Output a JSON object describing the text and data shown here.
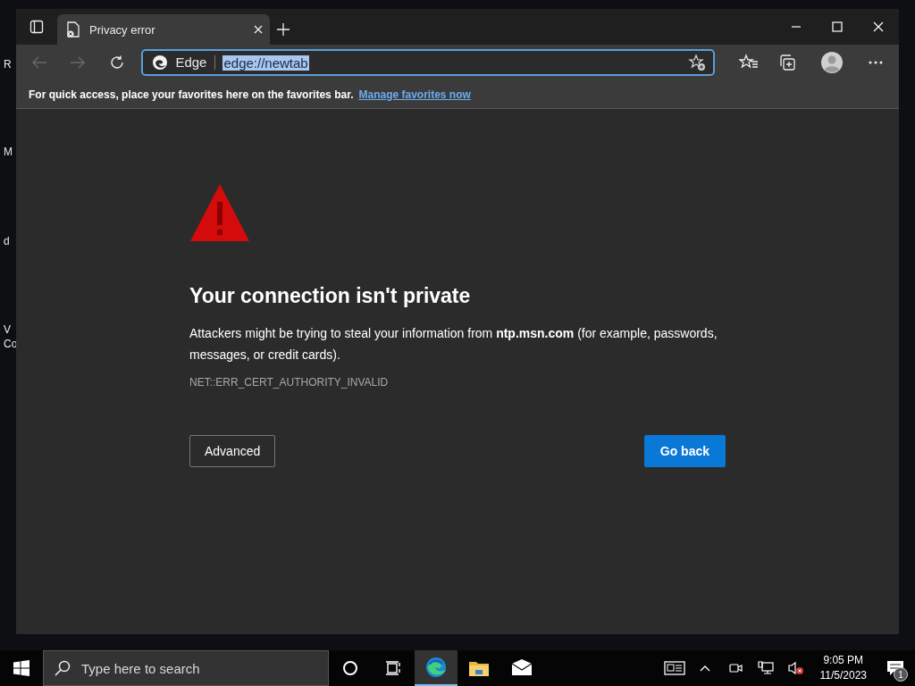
{
  "desktop": {
    "icon_labels": [
      {
        "text": "R"
      },
      {
        "text": "M"
      },
      {
        "text": "d"
      },
      {
        "text": "V"
      },
      {
        "text": "Co"
      }
    ]
  },
  "browser": {
    "tabs": [
      {
        "title": "Privacy error",
        "selected": true
      }
    ],
    "nav": {
      "back_disabled": true,
      "forward_disabled": true
    },
    "address": {
      "site_label": "Edge",
      "url": "edge://newtab",
      "url_selected": true
    },
    "favorites_bar": {
      "message": "For quick access, place your favorites here on the favorites bar.",
      "link": "Manage favorites now"
    },
    "page": {
      "heading": "Your connection isn't private",
      "body": "Attackers might be trying to steal your information from **ntp.msn.com** (for example, passwords, messages, or credit cards).",
      "error_code": "NET::ERR_CERT_AUTHORITY_INVALID",
      "buttons": [
        {
          "label": "Advanced",
          "kind": "secondary"
        },
        {
          "label": "Go back",
          "kind": "primary"
        }
      ]
    }
  },
  "taskbar": {
    "search": {
      "placeholder": "Type here to search"
    },
    "apps": [
      {
        "kind": "edge",
        "selected": true
      },
      {
        "kind": "folder",
        "selected": false
      },
      {
        "kind": "mail",
        "selected": false
      }
    ],
    "clock": {
      "time": "9:05 PM",
      "date": "11/5/2023"
    },
    "notification_count": "1"
  }
}
